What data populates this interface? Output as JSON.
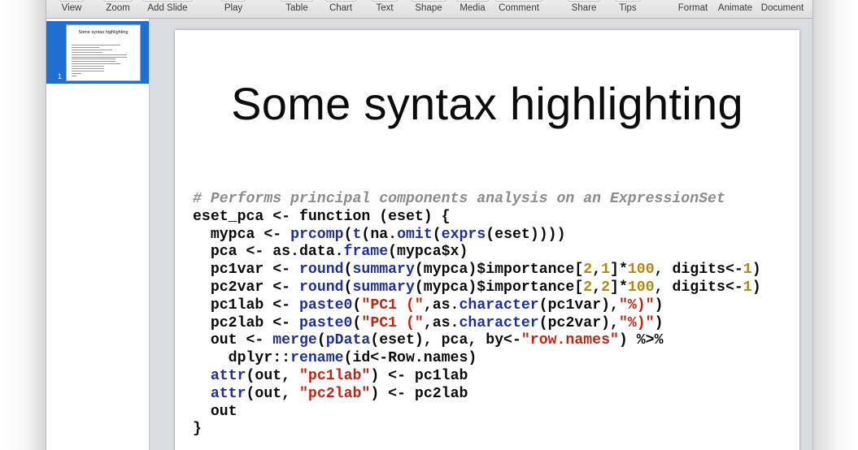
{
  "toolbar": {
    "buttons": [
      {
        "label": "View"
      },
      {
        "label": "Zoom"
      },
      {
        "label": "Add Slide"
      },
      {
        "label": "Play"
      },
      {
        "label": "Table"
      },
      {
        "label": "Chart"
      },
      {
        "label": "Text"
      },
      {
        "label": "Shape"
      },
      {
        "label": "Media"
      },
      {
        "label": "Comment"
      },
      {
        "label": "Share"
      },
      {
        "label": "Tips"
      },
      {
        "label": "Format"
      },
      {
        "label": "Animate"
      },
      {
        "label": "Document"
      }
    ]
  },
  "navigator": {
    "slides": [
      {
        "number": "1",
        "title": "Some syntax highlighting"
      }
    ]
  },
  "slide": {
    "title": "Some syntax highlighting",
    "code_lines": [
      [
        {
          "t": "# Performs principal components analysis on an ExpressionSet",
          "k": "comment"
        }
      ],
      [
        {
          "t": "eset_pca <- function (eset) {",
          "k": "plain"
        }
      ],
      [
        {
          "t": "  mypca <- ",
          "k": "plain"
        },
        {
          "t": "prcomp",
          "k": "fn"
        },
        {
          "t": "(",
          "k": "plain"
        },
        {
          "t": "t",
          "k": "fn"
        },
        {
          "t": "(na.",
          "k": "plain"
        },
        {
          "t": "omit",
          "k": "fn"
        },
        {
          "t": "(",
          "k": "plain"
        },
        {
          "t": "exprs",
          "k": "fn"
        },
        {
          "t": "(eset))))",
          "k": "plain"
        }
      ],
      [
        {
          "t": "  pca <- as.data.",
          "k": "plain"
        },
        {
          "t": "frame",
          "k": "fn"
        },
        {
          "t": "(mypca$x)",
          "k": "plain"
        }
      ],
      [
        {
          "t": "  pc1var <- ",
          "k": "plain"
        },
        {
          "t": "round",
          "k": "fn"
        },
        {
          "t": "(",
          "k": "plain"
        },
        {
          "t": "summary",
          "k": "fn"
        },
        {
          "t": "(mypca)$importance[",
          "k": "plain"
        },
        {
          "t": "2",
          "k": "num"
        },
        {
          "t": ",",
          "k": "plain"
        },
        {
          "t": "1",
          "k": "num"
        },
        {
          "t": "]*",
          "k": "plain"
        },
        {
          "t": "100",
          "k": "num"
        },
        {
          "t": ", digits<-",
          "k": "plain"
        },
        {
          "t": "1",
          "k": "num"
        },
        {
          "t": ")",
          "k": "plain"
        }
      ],
      [
        {
          "t": "  pc2var <- ",
          "k": "plain"
        },
        {
          "t": "round",
          "k": "fn"
        },
        {
          "t": "(",
          "k": "plain"
        },
        {
          "t": "summary",
          "k": "fn"
        },
        {
          "t": "(mypca)$importance[",
          "k": "plain"
        },
        {
          "t": "2",
          "k": "num"
        },
        {
          "t": ",",
          "k": "plain"
        },
        {
          "t": "2",
          "k": "num"
        },
        {
          "t": "]*",
          "k": "plain"
        },
        {
          "t": "100",
          "k": "num"
        },
        {
          "t": ", digits<-",
          "k": "plain"
        },
        {
          "t": "1",
          "k": "num"
        },
        {
          "t": ")",
          "k": "plain"
        }
      ],
      [
        {
          "t": "  pc1lab <- ",
          "k": "plain"
        },
        {
          "t": "paste0",
          "k": "fn"
        },
        {
          "t": "(",
          "k": "plain"
        },
        {
          "t": "\"PC1 (\"",
          "k": "str"
        },
        {
          "t": ",as.",
          "k": "plain"
        },
        {
          "t": "character",
          "k": "fn"
        },
        {
          "t": "(pc1var),",
          "k": "plain"
        },
        {
          "t": "\"%)\"",
          "k": "str"
        },
        {
          "t": ")",
          "k": "plain"
        }
      ],
      [
        {
          "t": "  pc2lab <- ",
          "k": "plain"
        },
        {
          "t": "paste0",
          "k": "fn"
        },
        {
          "t": "(",
          "k": "plain"
        },
        {
          "t": "\"PC1 (\"",
          "k": "str"
        },
        {
          "t": ",as.",
          "k": "plain"
        },
        {
          "t": "character",
          "k": "fn"
        },
        {
          "t": "(pc2var),",
          "k": "plain"
        },
        {
          "t": "\"%)\"",
          "k": "str"
        },
        {
          "t": ")",
          "k": "plain"
        }
      ],
      [
        {
          "t": "  out <- ",
          "k": "plain"
        },
        {
          "t": "merge",
          "k": "fn"
        },
        {
          "t": "(",
          "k": "plain"
        },
        {
          "t": "pData",
          "k": "fn"
        },
        {
          "t": "(eset), pca, by<-",
          "k": "plain"
        },
        {
          "t": "\"row.names\"",
          "k": "str"
        },
        {
          "t": ") %>%",
          "k": "plain"
        }
      ],
      [
        {
          "t": "    dplyr::",
          "k": "plain"
        },
        {
          "t": "rename",
          "k": "fn"
        },
        {
          "t": "(id<-Row.names)",
          "k": "plain"
        }
      ],
      [
        {
          "t": "  ",
          "k": "plain"
        },
        {
          "t": "attr",
          "k": "fn"
        },
        {
          "t": "(out, ",
          "k": "plain"
        },
        {
          "t": "\"pc1lab\"",
          "k": "str"
        },
        {
          "t": ") <- pc1lab",
          "k": "plain"
        }
      ],
      [
        {
          "t": "  ",
          "k": "plain"
        },
        {
          "t": "attr",
          "k": "fn"
        },
        {
          "t": "(out, ",
          "k": "plain"
        },
        {
          "t": "\"pc2lab\"",
          "k": "str"
        },
        {
          "t": ") <- pc2lab",
          "k": "plain"
        }
      ],
      [
        {
          "t": "  out",
          "k": "plain"
        }
      ],
      [
        {
          "t": "}",
          "k": "plain"
        }
      ]
    ]
  }
}
